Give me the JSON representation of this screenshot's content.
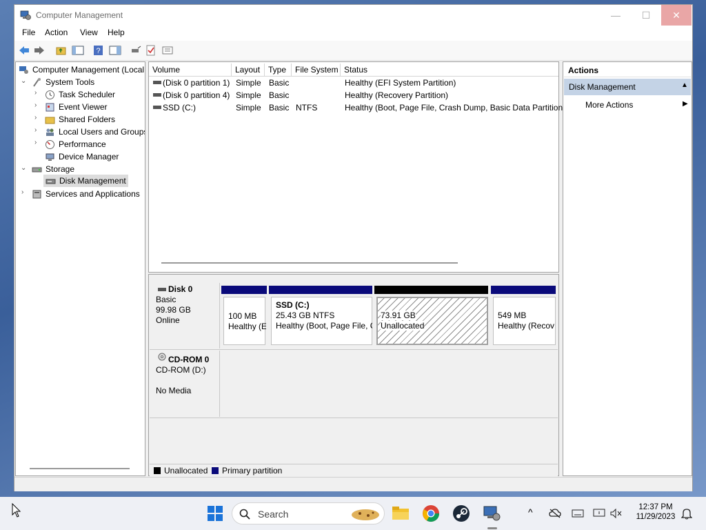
{
  "window": {
    "title": "Computer Management",
    "minimize": "—",
    "maximize": "☐",
    "close": "✕"
  },
  "menu": [
    "File",
    "Action",
    "View",
    "Help"
  ],
  "tree": {
    "root": "Computer Management (Local",
    "system_tools": "System Tools",
    "task_scheduler": "Task Scheduler",
    "event_viewer": "Event Viewer",
    "shared_folders": "Shared Folders",
    "local_users": "Local Users and Groups",
    "performance": "Performance",
    "device_manager": "Device Manager",
    "storage": "Storage",
    "disk_management": "Disk Management",
    "services": "Services and Applications"
  },
  "volume_table": {
    "columns": [
      "Volume",
      "Layout",
      "Type",
      "File System",
      "Status"
    ],
    "rows": [
      {
        "volume": "(Disk 0 partition 1)",
        "layout": "Simple",
        "type": "Basic",
        "fs": "",
        "status": "Healthy (EFI System Partition)"
      },
      {
        "volume": "(Disk 0 partition 4)",
        "layout": "Simple",
        "type": "Basic",
        "fs": "",
        "status": "Healthy (Recovery Partition)"
      },
      {
        "volume": "SSD (C:)",
        "layout": "Simple",
        "type": "Basic",
        "fs": "NTFS",
        "status": "Healthy (Boot, Page File, Crash Dump, Basic Data Partition)"
      }
    ]
  },
  "disk0": {
    "name": "Disk 0",
    "kind": "Basic",
    "size": "99.98 GB",
    "state": "Online",
    "partitions": [
      {
        "line1": "",
        "line2": "100 MB",
        "line3": "Healthy (E",
        "bar": "#0a0a7a"
      },
      {
        "line1": "SSD  (C:)",
        "line2": "25.43 GB NTFS",
        "line3": "Healthy (Boot, Page File, C",
        "bar": "#0a0a7a"
      },
      {
        "line1": "",
        "line2": "73.91 GB",
        "line3": "Unallocated",
        "bar": "#000000"
      },
      {
        "line1": "",
        "line2": "549 MB",
        "line3": "Healthy (Recov",
        "bar": "#0a0a7a"
      }
    ]
  },
  "cdrom": {
    "name": "CD-ROM 0",
    "drive": "CD-ROM (D:)",
    "media": "No Media"
  },
  "legend": {
    "unallocated": "Unallocated",
    "primary": "Primary partition",
    "unallocated_color": "#000000",
    "primary_color": "#0a0a7a"
  },
  "actions": {
    "header": "Actions",
    "section": "Disk Management",
    "more": "More Actions"
  },
  "taskbar": {
    "search_label": "Search",
    "time": "12:37 PM",
    "date": "11/29/2023"
  }
}
